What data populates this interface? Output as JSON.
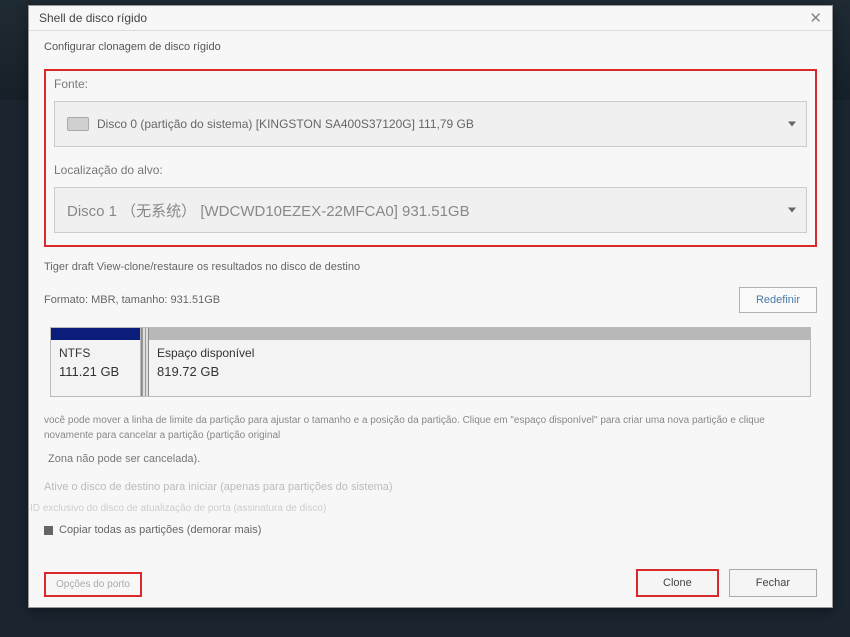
{
  "dialog": {
    "title": "Shell de disco rígido",
    "subtitle": "Configurar clonagem de disco rígido"
  },
  "source": {
    "label": "Fonte:",
    "selected": "Disco 0 (partição do sistema) [KINGSTON SA400S37120G] 111,79 GB"
  },
  "target": {
    "label": "Localização do alvo:",
    "selected": "Disco 1 （无系统） [WDCWD10EZEX-22MFCA0]   931.51GB"
  },
  "viewInfo": "Tiger draft View-clone/restaure os resultados no disco de destino",
  "format": {
    "text": "Formato: MBR, tamanho: 931.51GB",
    "redefineLabel": "Redefinir"
  },
  "partitions": [
    {
      "name": "NTFS",
      "size": "111.21 GB"
    },
    {
      "name": "Espaço disponível",
      "size": "819.72 GB"
    }
  ],
  "helpText": "você pode mover a linha de limite da partição para ajustar o tamanho e a posição da partição. Clique em \"espaço disponível\" para criar uma nova partição e clique novamente para cancelar a partição (partição original",
  "zoneText": "Zona não pode ser cancelada).",
  "options": {
    "activateDest": "Ative o disco de destino para iniciar (apenas para partições do sistema)",
    "exclusiveId": "ID exclusivo do disco de atualização de porta (assinatura de disco)",
    "copyAll": "Copiar todas as partições (demorar mais)"
  },
  "footer": {
    "portOptions": "Opções do porto",
    "cloneLabel": "Clone",
    "closeLabel": "Fechar"
  }
}
